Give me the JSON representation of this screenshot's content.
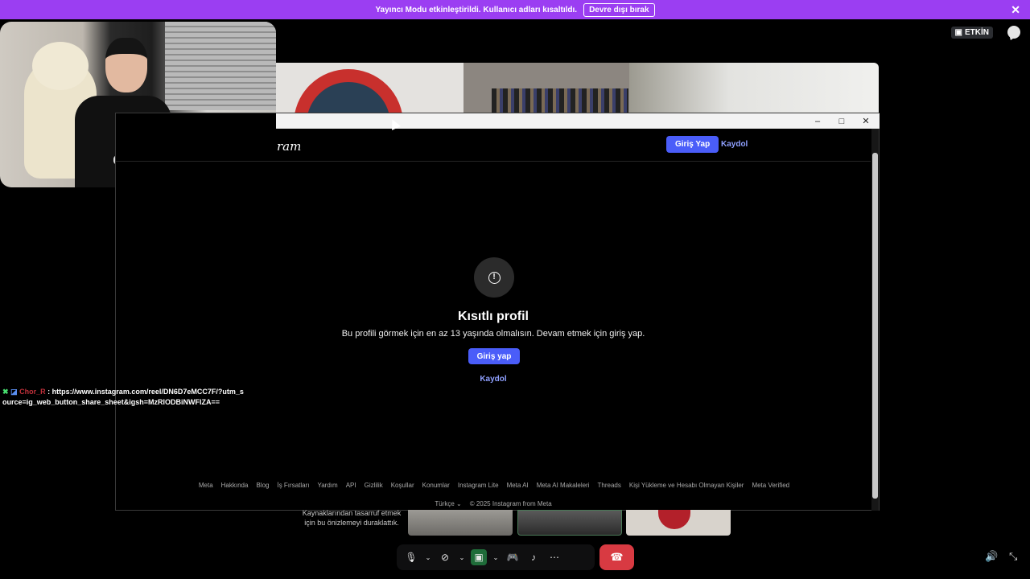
{
  "banner": {
    "text": "Yayıncı Modu etkinleştirildi. Kullanıcı adları kısaltıldı.",
    "button_label": "Devre dışı bırak",
    "close_icon": "close-icon"
  },
  "top_right": {
    "live_label": "ETKİN",
    "chat_icon": "chat-bubble-icon"
  },
  "browser": {
    "logo_partial": "ram",
    "nav": {
      "login_label": "Giriş Yap",
      "signup_label": "Kaydol"
    },
    "window_controls": {
      "minimize": "–",
      "maximize": "□",
      "close": "✕"
    },
    "restricted": {
      "icon": "alert-circle-icon",
      "title": "Kısıtlı profil",
      "description": "Bu profili görmek için en az 13 yaşında olmalısın. Devam etmek için giriş yap.",
      "login_label": "Giriş yap",
      "signup_label": "Kaydol"
    },
    "footer_links": [
      "Meta",
      "Hakkında",
      "Blog",
      "İş Fırsatları",
      "Yardım",
      "API",
      "Gizlilik",
      "Koşullar",
      "Konumlar",
      "Instagram Lite",
      "Meta AI",
      "Meta AI Makaleleri",
      "Threads",
      "Kişi Yükleme ve Hesabı Olmayan Kişiler",
      "Meta Verified"
    ],
    "language": "Türkçe",
    "copyright": "© 2025 Instagram from Meta"
  },
  "chat": {
    "nick": "Chor_R",
    "separator": ":",
    "message": "https://www.instagram.com/reel/DN6D7eMCC7F/?utm_source=ig_web_button_share_sheet&igsh=MzRlODBiNWFlZA=="
  },
  "preview": {
    "paused_text": "Kaynaklarından tasarruf etmek için bu önizlemeyi duraklattık."
  },
  "controls": {
    "mic_icon": "microphone-icon",
    "camera_icon": "camera-off-icon",
    "share_icon": "screen-share-icon",
    "activity_icon": "gamepad-icon",
    "soundboard_icon": "soundboard-icon",
    "more_icon": "more-icon",
    "hangup_icon": "hangup-icon",
    "volume_icon": "volume-icon",
    "fullscreen_icon": "exit-fullscreen-icon"
  },
  "colors": {
    "banner": "#9b3ef2",
    "accent_button": "#4a5df9",
    "link": "#8fa0ff",
    "hangup": "#d83a42"
  }
}
